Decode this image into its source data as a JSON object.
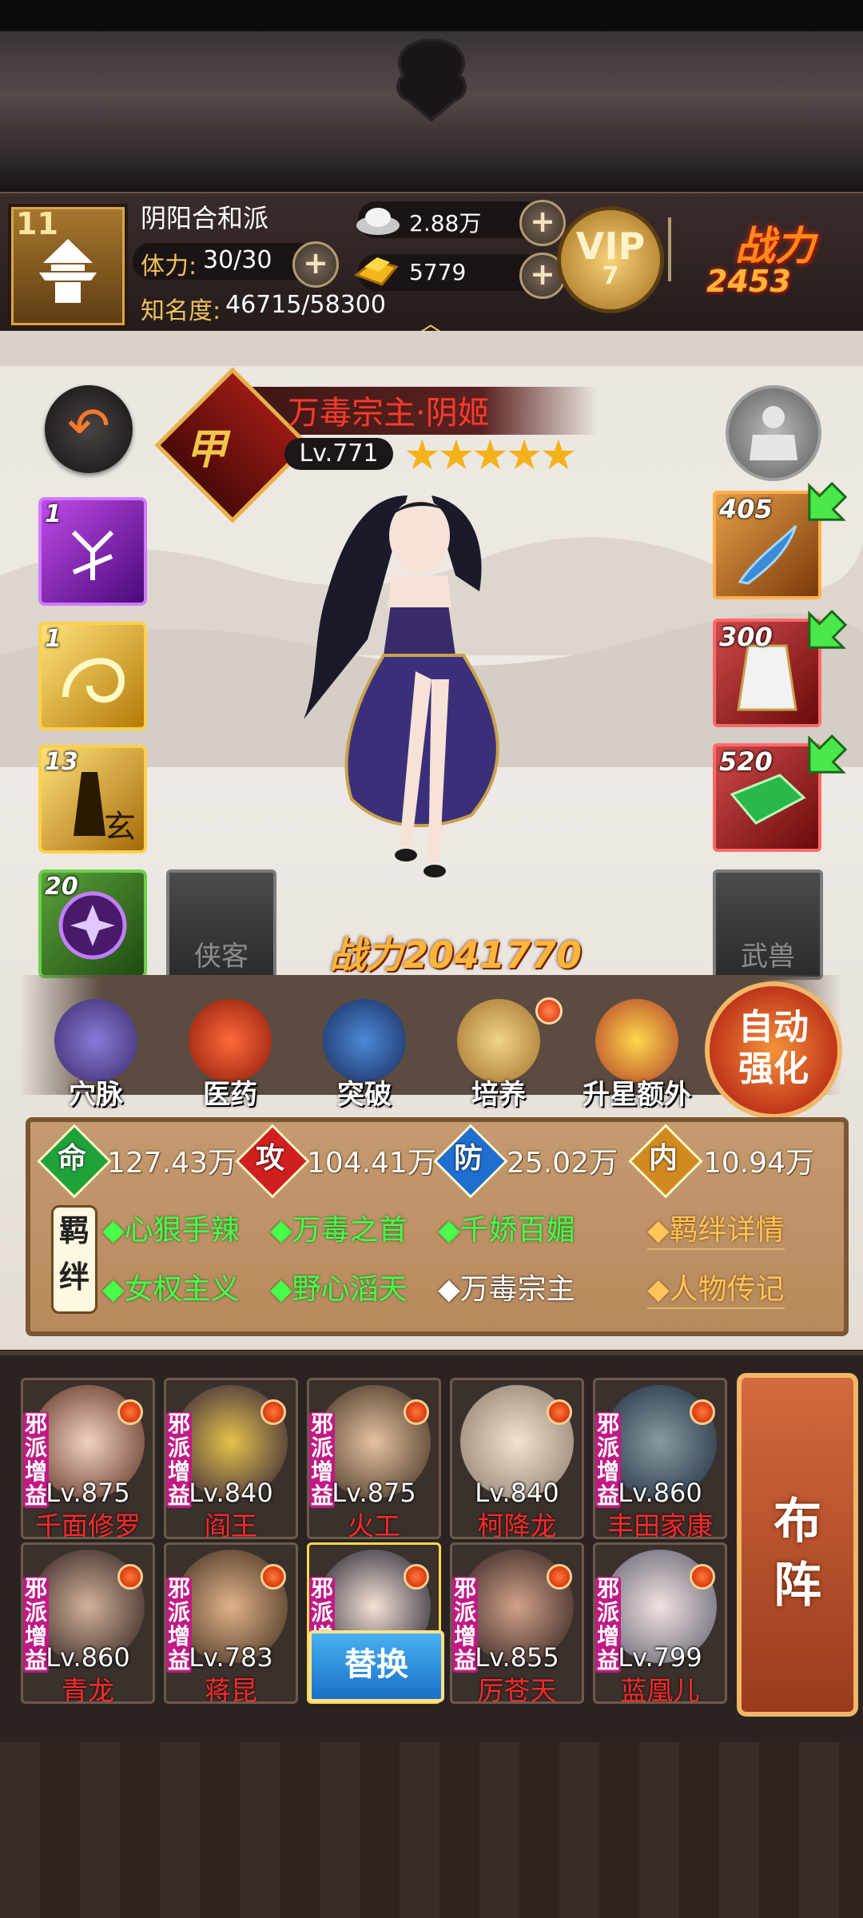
{
  "header": {
    "rank_number": "11",
    "sect_name": "阴阳合和派",
    "stamina_label": "体力:",
    "stamina_value": "30/30",
    "fame_label": "知名度:",
    "fame_value": "46715/58300",
    "silver": "2.88万",
    "gold": "5779",
    "vip_label": "VIP",
    "vip_level": "7",
    "power_label": "战力",
    "power_value": "2453"
  },
  "hero": {
    "title": "万毒宗主·阴姬",
    "level": "Lv.771",
    "stars": 5,
    "star_glyphs": "★★★★★",
    "power_label": "战力",
    "power_value": "2041770"
  },
  "skills": [
    {
      "level": "1",
      "color": "purple"
    },
    {
      "level": "1",
      "color": "gold"
    },
    {
      "level": "13",
      "color": "gold"
    },
    {
      "level": "20",
      "color": "green"
    }
  ],
  "equipment": [
    {
      "level": "405",
      "color": "orange"
    },
    {
      "level": "300",
      "color": "red"
    },
    {
      "level": "520",
      "color": "red"
    }
  ],
  "slots": {
    "companion_label": "侠客",
    "beast_label": "武兽"
  },
  "actions": [
    {
      "label": "穴脉",
      "icon": "meridian-icon",
      "dot": false
    },
    {
      "label": "医药",
      "icon": "medicine-icon",
      "dot": false
    },
    {
      "label": "突破",
      "icon": "breakthrough-icon",
      "dot": false
    },
    {
      "label": "培养",
      "icon": "cultivate-icon",
      "dot": true
    },
    {
      "label": "升星额外",
      "icon": "star-up-icon",
      "dot": false
    }
  ],
  "auto_button": "自动强化",
  "stats": [
    {
      "icon": "命",
      "value": "127.43万",
      "color": "#1fa23a"
    },
    {
      "icon": "攻",
      "value": "104.41万",
      "color": "#d01f1f"
    },
    {
      "icon": "防",
      "value": "25.02万",
      "color": "#1f6fd0"
    },
    {
      "icon": "内",
      "value": "10.94万",
      "color": "#d08a1f"
    }
  ],
  "bonds_badge": "羁绊",
  "bonds": [
    {
      "text": "◆心狠手辣",
      "active": true
    },
    {
      "text": "◆万毒之首",
      "active": true
    },
    {
      "text": "◆千娇百媚",
      "active": true
    },
    {
      "text": "◆女权主义",
      "active": true
    },
    {
      "text": "◆野心滔天",
      "active": true
    },
    {
      "text": "◆万毒宗主",
      "active": false
    }
  ],
  "links": {
    "bond_details": "◆羁绊详情",
    "biography": "◆人物传记"
  },
  "roster": [
    {
      "level": "Lv.875",
      "name": "千面修罗",
      "tag": "邪派增益"
    },
    {
      "level": "Lv.840",
      "name": "阎王",
      "tag": "邪派增益"
    },
    {
      "level": "Lv.875",
      "name": "火工",
      "tag": "邪派增益"
    },
    {
      "level": "Lv.840",
      "name": "柯降龙",
      "tag": ""
    },
    {
      "level": "Lv.860",
      "name": "丰田家康",
      "tag": "邪派增益"
    },
    {
      "level": "Lv.860",
      "name": "青龙",
      "tag": "邪派增益"
    },
    {
      "level": "Lv.783",
      "name": "蒋昆",
      "tag": "邪派增益"
    },
    {
      "level": "",
      "name": "",
      "tag": "邪派增益"
    },
    {
      "level": "Lv.855",
      "name": "厉苍天",
      "tag": "邪派增益"
    },
    {
      "level": "Lv.799",
      "name": "蓝凰儿",
      "tag": "邪派增益"
    }
  ],
  "replace_button": "替换",
  "formation_button": "布阵"
}
